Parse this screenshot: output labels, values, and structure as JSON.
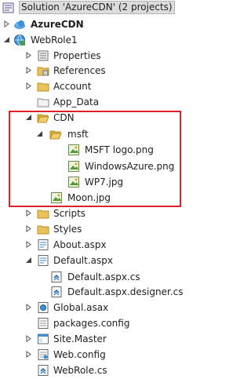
{
  "solution": {
    "label": "Solution 'AzureCDN' (2 projects)"
  },
  "projects": {
    "azurecdn": "AzureCDN",
    "webrole1": "WebRole1"
  },
  "items": {
    "properties": "Properties",
    "references": "References",
    "account": "Account",
    "app_data": "App_Data",
    "cdn": "CDN",
    "msft": "msft",
    "msft_logo": "MSFT logo.png",
    "windows_azure": "WindowsAzure.png",
    "wp7": "WP7.jpg",
    "moon": "Moon.jpg",
    "scripts": "Scripts",
    "styles": "Styles",
    "about": "About.aspx",
    "default": "Default.aspx",
    "default_cs": "Default.aspx.cs",
    "default_designer": "Default.aspx.designer.cs",
    "global": "Global.asax",
    "packages": "packages.config",
    "site_master": "Site.Master",
    "web_config": "Web.config",
    "webrole_cs": "WebRole.cs"
  },
  "colors": {
    "highlight_border": "#d8232a",
    "folder": "#e9c25c",
    "selection": "#dcdcdc"
  },
  "icons": {
    "solution": "solution-icon",
    "cloud_project": "cloud-project-icon",
    "web_project": "web-project-icon",
    "folder": "folder-icon",
    "image_file": "image-file-icon",
    "aspx_file": "aspx-file-icon",
    "cs_file": "cs-file-icon",
    "config_file": "config-file-icon"
  }
}
